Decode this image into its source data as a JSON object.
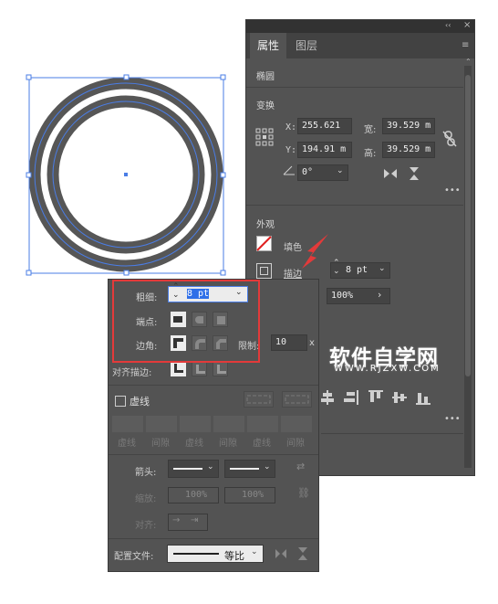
{
  "panel": {
    "tabs": [
      {
        "label": "属性"
      },
      {
        "label": "图层"
      }
    ],
    "object_type": "椭圆",
    "transform": {
      "heading": "变换",
      "x_label": "X:",
      "x_value": "255.621",
      "y_label": "Y:",
      "y_value": "194.91 m",
      "w_label": "宽:",
      "w_value": "39.529 m",
      "h_label": "高:",
      "h_value": "39.529 m",
      "angle_value": "0°"
    },
    "appearance": {
      "heading": "外观",
      "fill_label": "填色",
      "stroke_label": "描边",
      "stroke_value": "8 pt",
      "opacity_value": "100%"
    },
    "more": "•••"
  },
  "stroke_popup": {
    "weight_label": "粗细:",
    "weight_value": "8 pt",
    "cap_label": "端点:",
    "corner_label": "边角:",
    "limit_label": "限制:",
    "limit_value": "10",
    "limit_unit": "x",
    "align_label": "对齐描边:",
    "dashed_label": "虚线",
    "dash_labels": [
      "虚线",
      "间隙",
      "虚线",
      "间隙",
      "虚线",
      "间隙"
    ],
    "arrow_label": "箭头:",
    "scale_label": "缩放:",
    "scale_value_1": "100%",
    "scale_value_2": "100%",
    "align2_label": "对齐:",
    "profile_label": "配置文件:",
    "profile_value": "等比"
  },
  "watermark": {
    "main": "软件自学网",
    "sub": "WWW.RJZXW.COM"
  },
  "colors": {
    "panel_bg": "#535353",
    "ring": "#565656",
    "selection": "#4a7de6",
    "highlight": "#e33a3a"
  }
}
